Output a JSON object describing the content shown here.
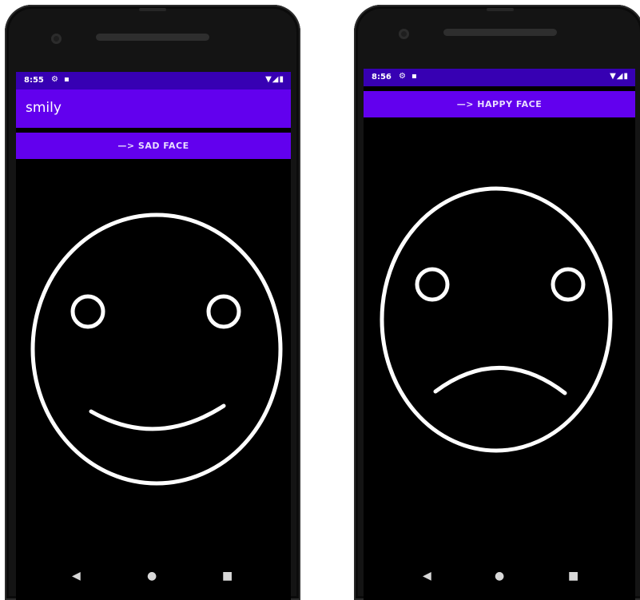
{
  "left_phone": {
    "status": {
      "time": "8:55"
    },
    "app_title": "smily",
    "button_label": "—> SAD FACE",
    "face": "happy-face"
  },
  "right_phone": {
    "status": {
      "time": "8:56"
    },
    "button_label": "—> HAPPY FACE",
    "face": "sad-face"
  },
  "icons": {
    "settings": "gear-icon",
    "notification": "sd-card-icon",
    "wifi": "wifi-icon",
    "signal": "signal-icon",
    "battery": "battery-icon",
    "back": "back-icon",
    "home": "home-icon",
    "recents": "recents-icon"
  },
  "colors": {
    "status_bar": "#3700b3",
    "app_bar": "#6200ee",
    "screen_bg": "#000000",
    "face_stroke": "#ffffff"
  }
}
